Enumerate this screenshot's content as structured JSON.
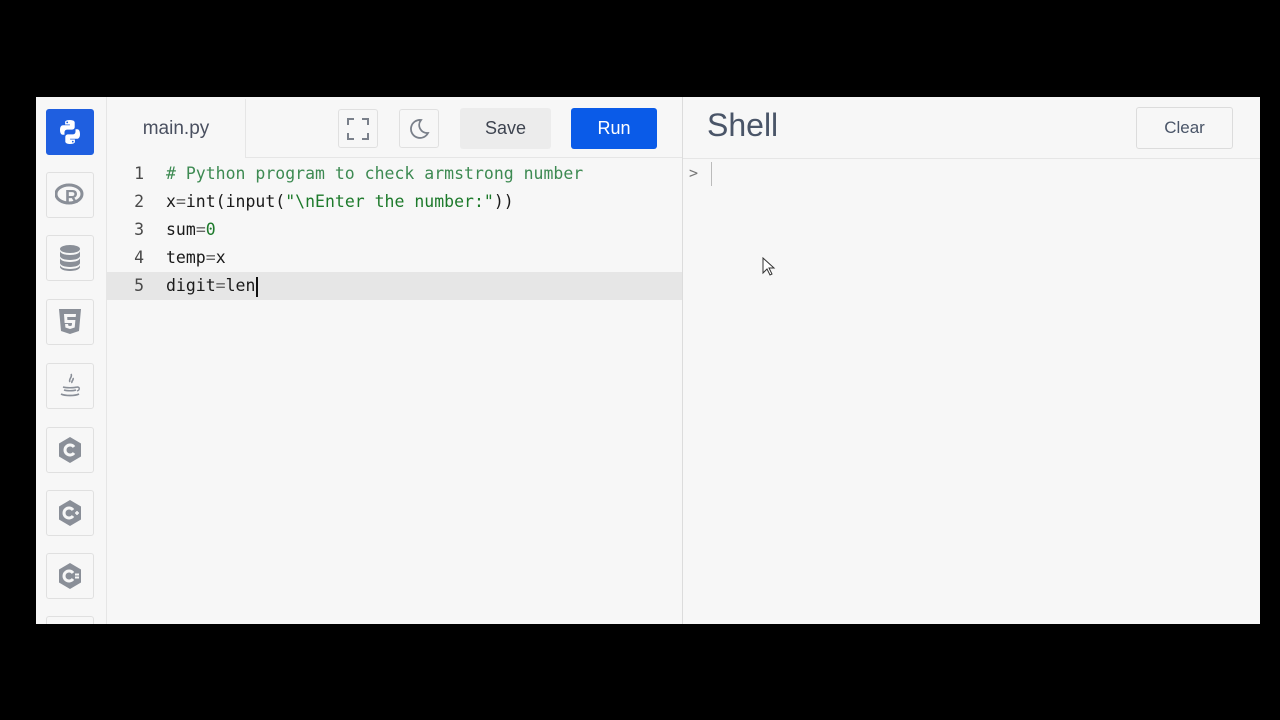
{
  "sidebar": {
    "languages": [
      {
        "name": "python-icon",
        "active": true
      },
      {
        "name": "r-icon",
        "active": false
      },
      {
        "name": "database-icon",
        "active": false
      },
      {
        "name": "html5-icon",
        "active": false
      },
      {
        "name": "java-icon",
        "active": false
      },
      {
        "name": "c-icon",
        "active": false
      },
      {
        "name": "cpp-icon",
        "active": false
      },
      {
        "name": "csharp-icon",
        "active": false
      }
    ]
  },
  "editor": {
    "tab_label": "main.py",
    "save_label": "Save",
    "run_label": "Run",
    "fullscreen_icon": "fullscreen-icon",
    "theme_icon": "moon-icon",
    "lines": [
      {
        "num": "1",
        "text": "# Python program to check armstrong number"
      },
      {
        "num": "2",
        "text": "x=int(input(\"\\nEnter the number:\"))"
      },
      {
        "num": "3",
        "text": "sum=0"
      },
      {
        "num": "4",
        "text": "temp=x"
      },
      {
        "num": "5",
        "text": "digit=len"
      }
    ]
  },
  "shell": {
    "title": "Shell",
    "clear_label": "Clear",
    "prompt": ">"
  },
  "colors": {
    "accent": "#0a5be8",
    "active_icon_bg": "#1f5fe0",
    "comment": "#3d8a52"
  }
}
